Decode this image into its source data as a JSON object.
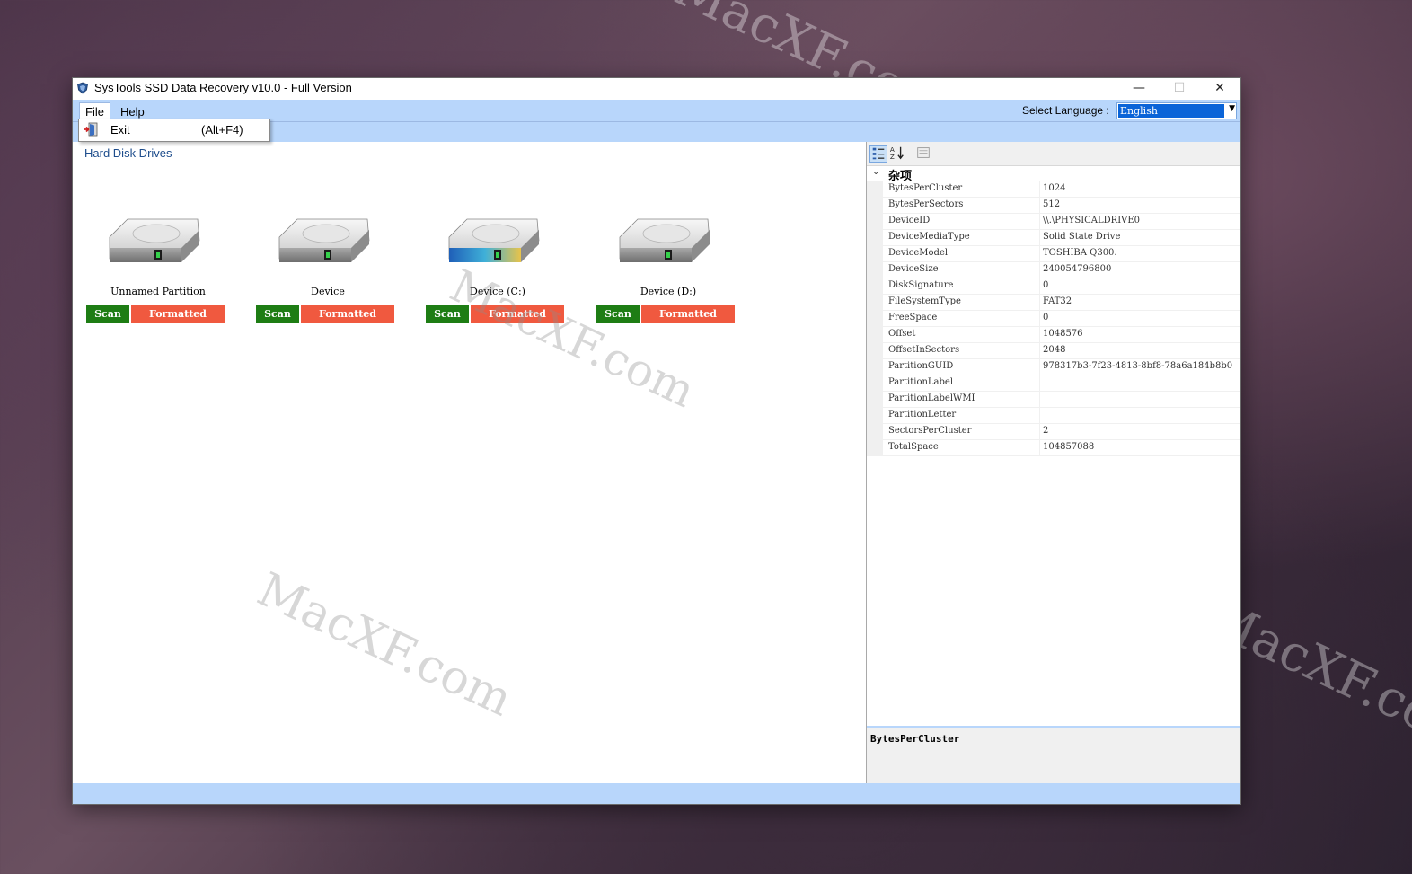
{
  "window": {
    "title": "SysTools SSD Data Recovery v10.0 - Full Version",
    "minimize_glyph": "—",
    "maximize_glyph": "☐",
    "close_glyph": "✕"
  },
  "menu": {
    "file_label": "File",
    "help_label": "Help",
    "language_label": "Select Language :",
    "language_value": "English",
    "file_dropdown": {
      "exit_label": "Exit",
      "exit_shortcut": "(Alt+F4)"
    }
  },
  "drives_panel": {
    "section_title": "Hard Disk Drives",
    "drives": [
      {
        "label": "Unnamed Partition",
        "scan_label": "Scan",
        "formatted_label": "Formatted",
        "selected": false
      },
      {
        "label": "Device",
        "scan_label": "Scan",
        "formatted_label": "Formatted",
        "selected": false
      },
      {
        "label": "Device (C:)",
        "scan_label": "Scan",
        "formatted_label": "Formatted",
        "selected": true
      },
      {
        "label": "Device (D:)",
        "scan_label": "Scan",
        "formatted_label": "Formatted",
        "selected": false
      }
    ]
  },
  "properties": {
    "category": "杂项",
    "rows": [
      {
        "name": "BytesPerCluster",
        "value": "1024"
      },
      {
        "name": "BytesPerSectors",
        "value": "512"
      },
      {
        "name": "DeviceID",
        "value": "\\\\.\\PHYSICALDRIVE0"
      },
      {
        "name": "DeviceMediaType",
        "value": "Solid State Drive"
      },
      {
        "name": "DeviceModel",
        "value": "TOSHIBA Q300."
      },
      {
        "name": "DeviceSize",
        "value": "240054796800"
      },
      {
        "name": "DiskSignature",
        "value": "0"
      },
      {
        "name": "FileSystemType",
        "value": "FAT32"
      },
      {
        "name": "FreeSpace",
        "value": "0"
      },
      {
        "name": "Offset",
        "value": "1048576"
      },
      {
        "name": "OffsetInSectors",
        "value": "2048"
      },
      {
        "name": "PartitionGUID",
        "value": "978317b3-7f23-4813-8bf8-78a6a184b8b0"
      },
      {
        "name": "PartitionLabel",
        "value": ""
      },
      {
        "name": "PartitionLabelWMI",
        "value": ""
      },
      {
        "name": "PartitionLetter",
        "value": ""
      },
      {
        "name": "SectorsPerCluster",
        "value": "2"
      },
      {
        "name": "TotalSpace",
        "value": "104857088"
      }
    ],
    "description_title": "BytesPerCluster"
  },
  "watermark": "MacXF.com",
  "colors": {
    "menubar": "#b8d6fb",
    "scan_button": "#1e7d14",
    "formatted_button": "#f0593f",
    "section_title": "#1e4d8c",
    "language_highlight": "#0a64d8"
  }
}
